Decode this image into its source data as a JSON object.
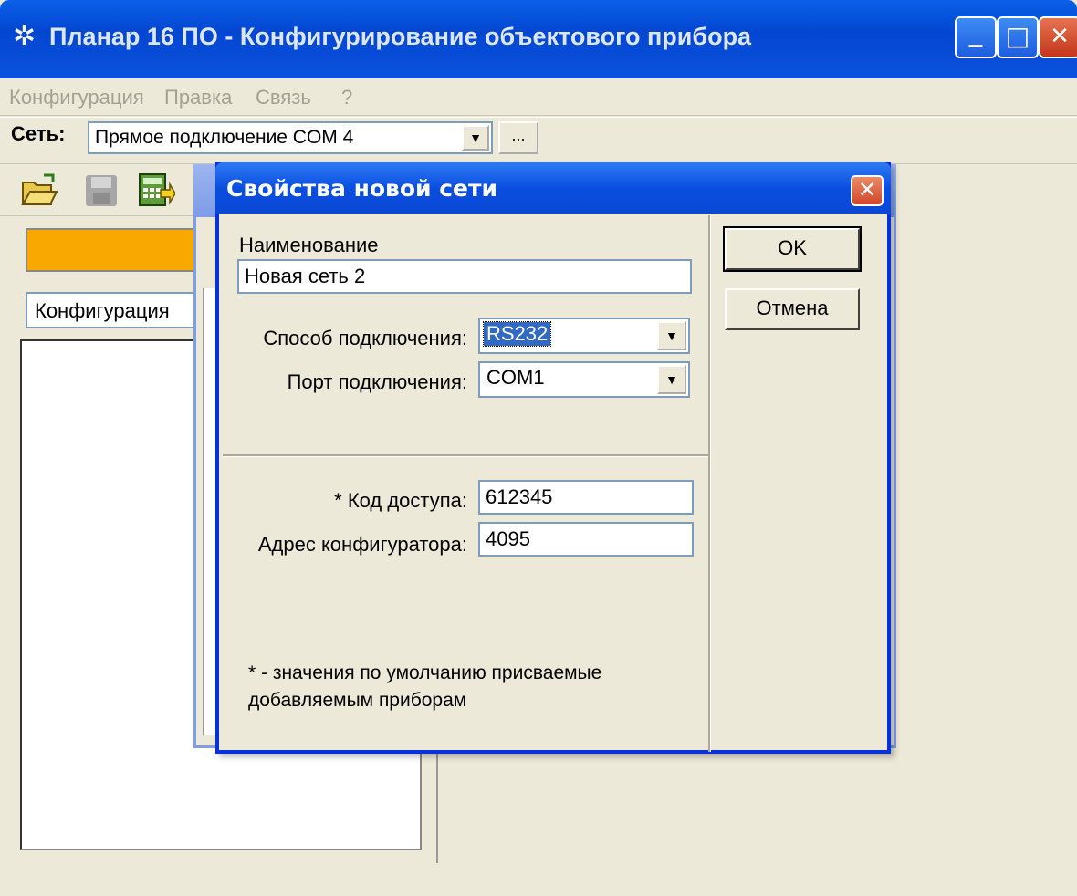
{
  "window": {
    "title": "Планар 16 ПО - Конфигурирование объектового прибора",
    "minimize": "_",
    "maximize": "□",
    "close": "✕"
  },
  "menu": [
    "Конфигурация",
    "Правка",
    "Связь",
    "?"
  ],
  "network": {
    "label": "Сеть:",
    "selected": "Прямое подключение COM 4",
    "more_button": "..."
  },
  "left": {
    "combo_value": "Конфигурация"
  },
  "dialog": {
    "title": "Свойства новой сети",
    "close": "✕",
    "name_label": "Наименование",
    "name_value": "Новая сеть 2",
    "connection_method_label": "Способ подключения:",
    "connection_method_value": "RS232",
    "port_label": "Порт подключения:",
    "port_value": "COM1",
    "access_code_label": "* Код доступа:",
    "access_code_value": "612345",
    "configurator_address_label": "Адрес конфигуратора:",
    "configurator_address_value": "4095",
    "note_line1": "* - значения по умолчанию присваемые",
    "note_line2": "добавляемым приборам",
    "ok_label": "OK",
    "cancel_label": "Отмена"
  }
}
